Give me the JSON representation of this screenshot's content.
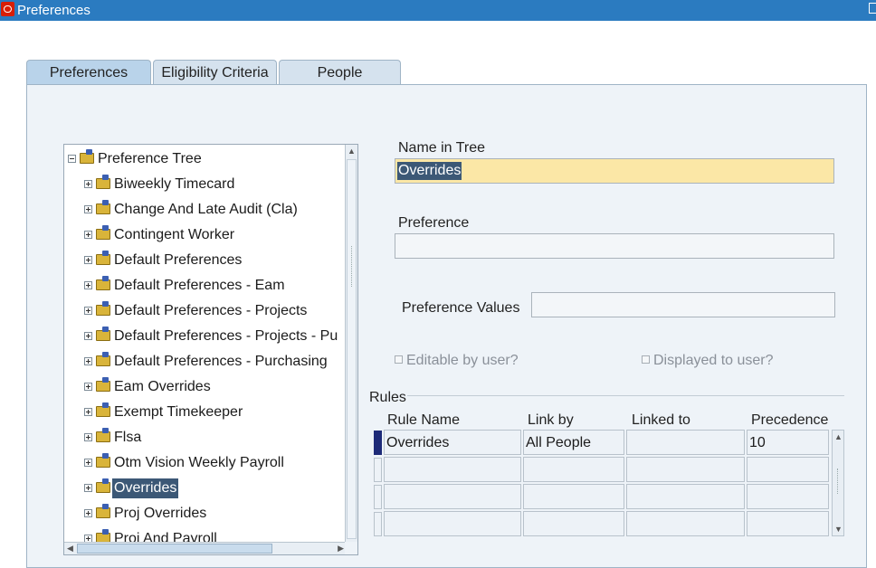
{
  "window": {
    "title": "Preferences"
  },
  "tabs": [
    {
      "label": "Preferences",
      "active": true
    },
    {
      "label": "Eligibility Criteria",
      "active": false
    },
    {
      "label": "People",
      "active": false
    }
  ],
  "tree": {
    "root": "Preference Tree",
    "items": [
      "Biweekly Timecard",
      "Change And Late Audit (Cla)",
      "Contingent Worker",
      "Default Preferences",
      "Default Preferences - Eam",
      "Default Preferences - Projects",
      "Default Preferences - Projects - Pu",
      "Default Preferences - Purchasing",
      "Eam Overrides",
      "Exempt Timekeeper",
      "Flsa",
      "Otm Vision Weekly Payroll",
      "Overrides",
      "Proj Overrides",
      "Proj And Payroll"
    ],
    "selected": "Overrides"
  },
  "form": {
    "name_in_tree_label": "Name in Tree",
    "name_in_tree_value": "Overrides",
    "preference_label": "Preference",
    "preference_value": "",
    "preference_values_label": "Preference Values",
    "preference_values_value": "",
    "editable_label": "Editable by user?",
    "displayed_label": "Displayed to user?"
  },
  "rules": {
    "label": "Rules",
    "columns": [
      "Rule Name",
      "Link by",
      "Linked to",
      "Precedence"
    ],
    "rows": [
      [
        "Overrides",
        "All People",
        "",
        "10"
      ],
      [
        "",
        "",
        "",
        ""
      ],
      [
        "",
        "",
        "",
        ""
      ],
      [
        "",
        "",
        "",
        ""
      ]
    ]
  },
  "colors": {
    "titlebar": "#2b7bc0",
    "selection": "#3c5876",
    "focus_field": "#fbe7a6",
    "panel": "#eef3f8"
  }
}
